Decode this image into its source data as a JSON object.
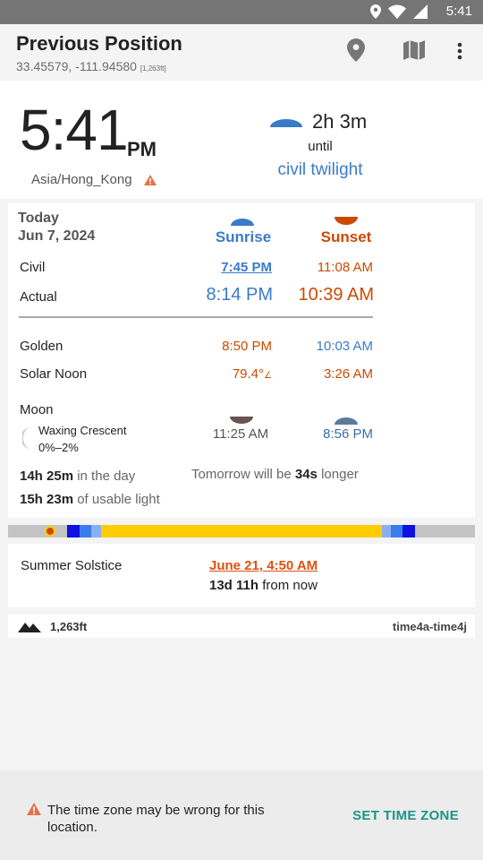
{
  "status": {
    "time": "5:41"
  },
  "appbar": {
    "title": "Previous Position",
    "coords": "33.45579, -111.94580",
    "alt_small": "[1,263ft]",
    "icons": [
      "location-pin-icon",
      "map-icon",
      "overflow-menu-icon"
    ]
  },
  "clock": {
    "time": "5:41",
    "ampm": "PM",
    "timezone": "Asia/Hong_Kong",
    "duration": "2h 3m",
    "until": "until",
    "event": "civil twilight"
  },
  "day": {
    "today": "Today",
    "date": "Jun 7, 2024",
    "sunrise_header": "Sunrise",
    "sunset_header": "Sunset",
    "rows": {
      "civil": {
        "label": "Civil",
        "sunrise": "7:45 PM",
        "sunset": "11:08 AM"
      },
      "actual": {
        "label": "Actual",
        "sunrise": "8:14 PM",
        "sunset": "10:39 AM"
      },
      "golden": {
        "label": "Golden",
        "sunrise": "8:50 PM",
        "sunset": "10:03 AM"
      },
      "noon": {
        "label": "Solar Noon",
        "angle": "79.4°",
        "angle_suffix": "∠",
        "time": "3:26 AM"
      }
    },
    "moon": {
      "label": "Moon",
      "phase": "Waxing Crescent",
      "illumination": "0%–2%",
      "moonrise": "11:25 AM",
      "moonset": "8:56 PM"
    },
    "daylength": {
      "value": "14h 25m",
      "suffix": "in the day"
    },
    "usable": {
      "value": "15h 23m",
      "suffix": "of usable light"
    },
    "tomorrow": {
      "prefix": "Tomorrow will be",
      "value": "34s",
      "suffix": "longer"
    }
  },
  "solstice": {
    "label": "Summer Solstice",
    "datetime": "June 21, 4:50 AM",
    "from_value": "13d 11h",
    "from_suffix": "from now"
  },
  "footer": {
    "altitude": "1,263ft",
    "plugin": "time4a-time4j"
  },
  "snackbar": {
    "message": "The time zone may be wrong for this location.",
    "action": "SET TIME ZONE"
  },
  "colors": {
    "sunrise_blue": "#3a7bc8",
    "sunset_orange": "#cc4a00",
    "accent_teal": "#1a9588",
    "warning": "#e0734a",
    "day_yellow": "#ffcc00"
  }
}
